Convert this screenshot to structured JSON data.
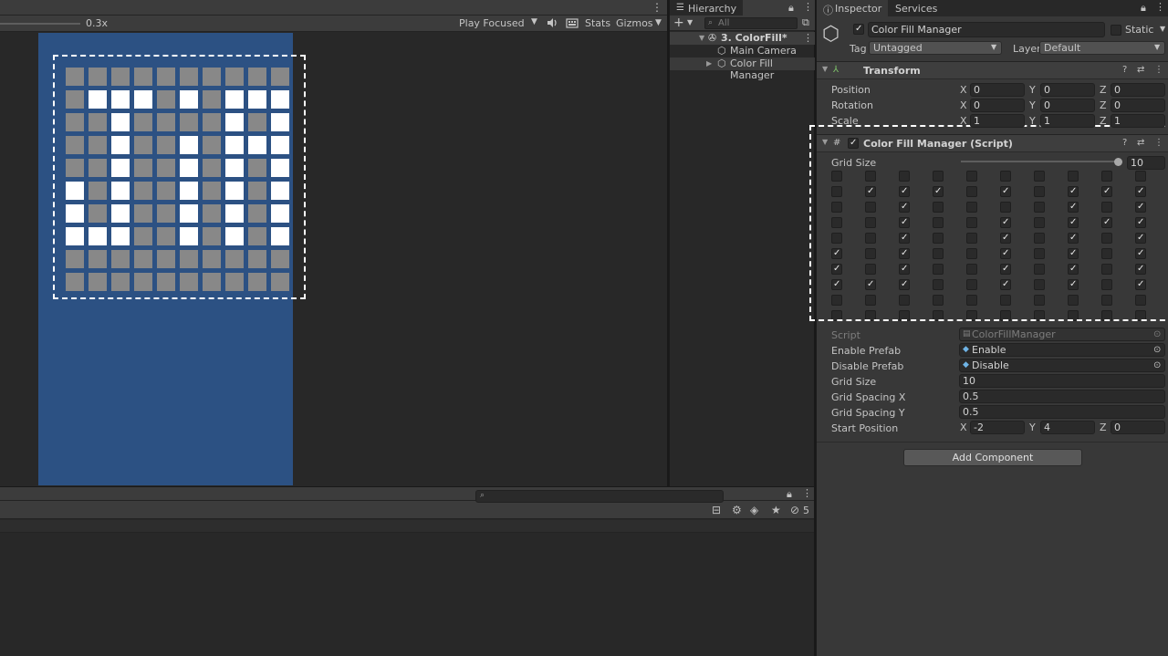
{
  "game_view": {
    "scale_label": "0.3x",
    "play_mode": "Play Focused",
    "stats_label": "Stats",
    "gizmos_label": "Gizmos",
    "grid": [
      [
        0,
        0,
        0,
        0,
        0,
        0,
        0,
        0,
        0,
        0
      ],
      [
        0,
        1,
        1,
        1,
        0,
        1,
        0,
        1,
        1,
        1
      ],
      [
        0,
        0,
        1,
        0,
        0,
        0,
        0,
        1,
        0,
        1
      ],
      [
        0,
        0,
        1,
        0,
        0,
        1,
        0,
        1,
        1,
        1
      ],
      [
        0,
        0,
        1,
        0,
        0,
        1,
        0,
        1,
        0,
        1
      ],
      [
        1,
        0,
        1,
        0,
        0,
        1,
        0,
        1,
        0,
        1
      ],
      [
        1,
        0,
        1,
        0,
        0,
        1,
        0,
        1,
        0,
        1
      ],
      [
        1,
        1,
        1,
        0,
        0,
        1,
        0,
        1,
        0,
        1
      ],
      [
        0,
        0,
        0,
        0,
        0,
        0,
        0,
        0,
        0,
        0
      ],
      [
        0,
        0,
        0,
        0,
        0,
        0,
        0,
        0,
        0,
        0
      ]
    ],
    "colors": {
      "on": "#ffffff",
      "off": "#888888",
      "camera_bg": "#2c5183"
    }
  },
  "hierarchy": {
    "tab_label": "Hierarchy",
    "search_placeholder": "All",
    "scene": "3. ColorFill*",
    "items": [
      "Main Camera",
      "Color Fill Manager"
    ]
  },
  "console": {
    "hidden_count": "5"
  },
  "inspector": {
    "tab_label": "Inspector",
    "services_label": "Services",
    "object_name": "Color Fill Manager",
    "static_label": "Static",
    "tag_label": "Tag",
    "tag_value": "Untagged",
    "layer_label": "Layer",
    "layer_value": "Default",
    "transform": {
      "title": "Transform",
      "position_label": "Position",
      "rotation_label": "Rotation",
      "scale_label": "Scale",
      "position": [
        "0",
        "0",
        "0"
      ],
      "rotation": [
        "0",
        "0",
        "0"
      ],
      "scale": [
        "1",
        "1",
        "1"
      ]
    },
    "axes": [
      "X",
      "Y",
      "Z"
    ],
    "script_component": {
      "title": "Color Fill Manager (Script)",
      "grid_size_slider_label": "Grid Size",
      "grid_size_slider_value": "10",
      "toggles": [
        [
          0,
          0,
          0,
          0,
          0,
          0,
          0,
          0,
          0,
          0
        ],
        [
          0,
          1,
          1,
          1,
          0,
          1,
          0,
          1,
          1,
          1
        ],
        [
          0,
          0,
          1,
          0,
          0,
          0,
          0,
          1,
          0,
          1
        ],
        [
          0,
          0,
          1,
          0,
          0,
          1,
          0,
          1,
          1,
          1
        ],
        [
          0,
          0,
          1,
          0,
          0,
          1,
          0,
          1,
          0,
          1
        ],
        [
          1,
          0,
          1,
          0,
          0,
          1,
          0,
          1,
          0,
          1
        ],
        [
          1,
          0,
          1,
          0,
          0,
          1,
          0,
          1,
          0,
          1
        ],
        [
          1,
          1,
          1,
          0,
          0,
          1,
          0,
          1,
          0,
          1
        ],
        [
          0,
          0,
          0,
          0,
          0,
          0,
          0,
          0,
          0,
          0
        ],
        [
          0,
          0,
          0,
          0,
          0,
          0,
          0,
          0,
          0,
          0
        ]
      ],
      "script_label": "Script",
      "script_value": "ColorFillManager",
      "enable_prefab_label": "Enable Prefab",
      "enable_prefab_value": "Enable",
      "disable_prefab_label": "Disable Prefab",
      "disable_prefab_value": "Disable",
      "grid_size_label": "Grid Size",
      "grid_size_value": "10",
      "grid_spacing_x_label": "Grid Spacing X",
      "grid_spacing_x_value": "0.5",
      "grid_spacing_y_label": "Grid Spacing Y",
      "grid_spacing_y_value": "0.5",
      "start_position_label": "Start Position",
      "start_position": [
        "-2",
        "4",
        "0"
      ]
    },
    "add_component_label": "Add Component"
  }
}
